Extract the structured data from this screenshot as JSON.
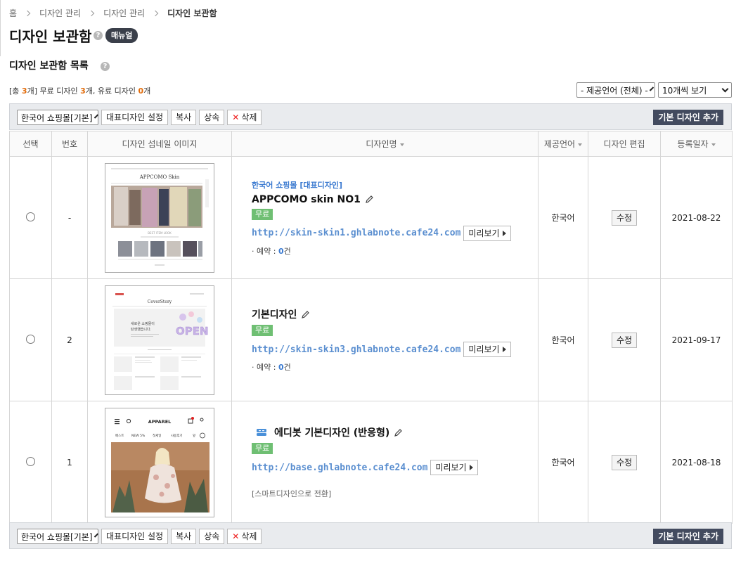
{
  "breadcrumb": [
    "홈",
    "디자인 관리",
    "디자인 관리",
    "디자인 보관함"
  ],
  "page_title": "디자인 보관함",
  "manual_label": "매뉴얼",
  "help_glyph": "?",
  "section_title": "디자인 보관함 목록",
  "summary": {
    "prefix": "[총 ",
    "total": "3",
    "mid1": "개] 무료 디자인 ",
    "free": "3",
    "mid2": "개, 유료 디자인 ",
    "paid": "0",
    "suffix": "개"
  },
  "filters": {
    "language": "- 제공언어 (전체) -",
    "per_page": "10개씩 보기"
  },
  "toolbar": {
    "mall_select": "한국어 쇼핑몰[기본]",
    "set_rep_label": "대표디자인 설정",
    "copy_label": "복사",
    "inherit_label": "상속",
    "delete_label": "삭제",
    "delete_glyph": "✕",
    "add_default_label": "기본 디자인 추가"
  },
  "columns": {
    "select": "선택",
    "number": "번호",
    "thumb": "디자인 섬네일 이미지",
    "name": "디자인명",
    "language": "제공언어",
    "edit": "디자인 편집",
    "date": "등록일자"
  },
  "rows": [
    {
      "number": "-",
      "rep_label": "한국어 쇼핑몰 [대표디자인]",
      "name": "APPCOMO skin NO1",
      "badge": "무료",
      "url": "http://skin-skin1.ghlabnote.cafe24.com",
      "preview_label": "미리보기",
      "reserve_label": "· 예약 : ",
      "reserve_count": "0",
      "reserve_unit": "건",
      "language": "한국어",
      "edit_label": "수정",
      "date": "2021-08-22",
      "thumb_brand": "APPCOMO Skin",
      "thumb_caption": "BEST ITEM LOOK"
    },
    {
      "number": "2",
      "name": "기본디자인",
      "badge": "무료",
      "url": "http://skin-skin3.ghlabnote.cafe24.com",
      "preview_label": "미리보기",
      "reserve_label": "· 예약 : ",
      "reserve_count": "0",
      "reserve_unit": "건",
      "language": "한국어",
      "edit_label": "수정",
      "date": "2021-09-17",
      "thumb_brand": "CoverStory",
      "thumb_text1": "새로운 쇼핑몰이",
      "thumb_text2": "탄생했습니다.",
      "thumb_open": "OPEN"
    },
    {
      "number": "1",
      "name": "에디봇 기본디자인 (반응형)",
      "badge": "무료",
      "url": "http://base.ghlabnote.cafe24.com",
      "preview_label": "미리보기",
      "smart_note": "[스마트디자인으로 전환]",
      "language": "한국어",
      "edit_label": "수정",
      "date": "2021-08-18",
      "thumb_brand": "APPAREL",
      "thumb_menu": [
        "베스트",
        "NEW 5%",
        "첫세일",
        "사용후기",
        "잎"
      ]
    }
  ],
  "colors": {
    "accent_orange": "#e36c0a",
    "link_blue": "#3b7ad0",
    "free_green": "#6fbf73",
    "dark_button": "#434b5f"
  }
}
